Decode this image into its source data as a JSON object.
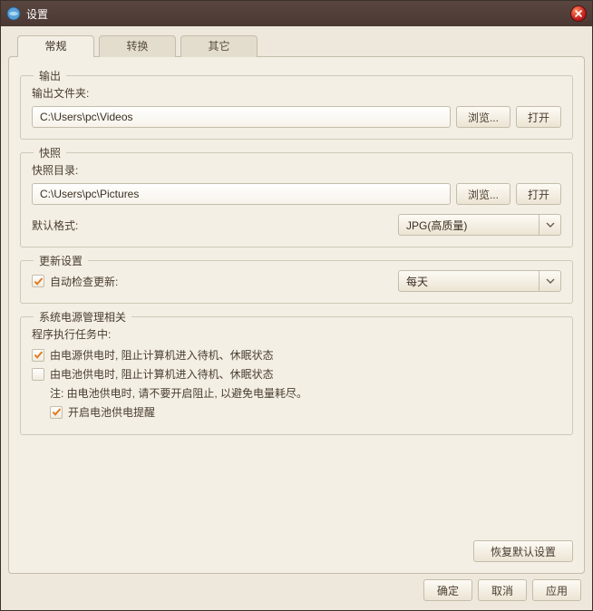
{
  "window": {
    "title": "设置"
  },
  "tabs": {
    "general": "常规",
    "convert": "转换",
    "other": "其它"
  },
  "output": {
    "legend": "输出",
    "folder_label": "输出文件夹:",
    "folder_value": "C:\\Users\\pc\\Videos",
    "browse": "浏览...",
    "open": "打开"
  },
  "snapshot": {
    "legend": "快照",
    "dir_label": "快照目录:",
    "dir_value": "C:\\Users\\pc\\Pictures",
    "browse": "浏览...",
    "open": "打开",
    "format_label": "默认格式:",
    "format_value": "JPG(高质量)"
  },
  "update": {
    "legend": "更新设置",
    "auto_check_label": "自动检查更新:",
    "interval_value": "每天"
  },
  "power": {
    "legend": "系统电源管理相关",
    "running_label": "程序执行任务中:",
    "ac_label": "由电源供电时, 阻止计算机进入待机、休眠状态",
    "battery_label": "由电池供电时, 阻止计算机进入待机、休眠状态",
    "note": "注: 由电池供电时, 请不要开启阻止, 以避免电量耗尽。",
    "remind_label": "开启电池供电提醒"
  },
  "buttons": {
    "restore": "恢复默认设置",
    "ok": "确定",
    "cancel": "取消",
    "apply": "应用"
  }
}
